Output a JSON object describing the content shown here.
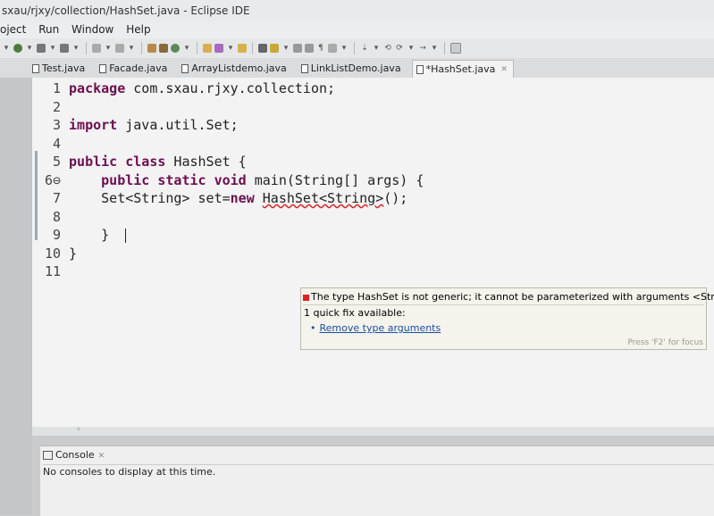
{
  "window": {
    "title": "sxau/rjxy/collection/HashSet.java - Eclipse IDE"
  },
  "menu": {
    "items": [
      "oject",
      "Run",
      "Window",
      "Help"
    ]
  },
  "tabs": [
    {
      "label": "Test.java",
      "active": false
    },
    {
      "label": "Facade.java",
      "active": false
    },
    {
      "label": "ArrayListdemo.java",
      "active": false
    },
    {
      "label": "LinkListDemo.java",
      "active": false
    },
    {
      "label": "*HashSet.java",
      "active": true,
      "close": "✕"
    }
  ],
  "editor": {
    "lines": [
      {
        "n": "1",
        "tokens": [
          {
            "t": "package",
            "k": "kw"
          },
          {
            "t": " com.sxau.rjxy.collection;"
          }
        ]
      },
      {
        "n": "2",
        "tokens": []
      },
      {
        "n": "3",
        "tokens": [
          {
            "t": "import",
            "k": "kw"
          },
          {
            "t": " java.util.Set;"
          }
        ]
      },
      {
        "n": "4",
        "tokens": []
      },
      {
        "n": "5",
        "tokens": [
          {
            "t": "public",
            "k": "kw"
          },
          {
            "t": " "
          },
          {
            "t": "class",
            "k": "kw"
          },
          {
            "t": " HashSet {"
          }
        ]
      },
      {
        "n": "6⊖",
        "tokens": [
          {
            "t": "    "
          },
          {
            "t": "public",
            "k": "kw"
          },
          {
            "t": " "
          },
          {
            "t": "static",
            "k": "kw"
          },
          {
            "t": " "
          },
          {
            "t": "void",
            "k": "kw"
          },
          {
            "t": " main(String[] args) {"
          }
        ]
      },
      {
        "n": "7",
        "tokens": [
          {
            "t": "    Set<String> set="
          },
          {
            "t": "new",
            "k": "kw"
          },
          {
            "t": " "
          },
          {
            "t": "HashSet<String>",
            "k": "err"
          },
          {
            "t": "();"
          }
        ]
      },
      {
        "n": "8",
        "tokens": []
      },
      {
        "n": "9",
        "tokens": [
          {
            "t": "    }  "
          }
        ],
        "cursor": true
      },
      {
        "n": "10",
        "tokens": [
          {
            "t": "}"
          }
        ]
      },
      {
        "n": "11",
        "tokens": []
      }
    ]
  },
  "hover": {
    "message": "The type HashSet is not generic; it cannot be parameterized with arguments <String>",
    "quickfix": "1 quick fix available:",
    "fix": "Remove type arguments",
    "hint": "Press 'F2' for focus"
  },
  "console": {
    "tab": "Console",
    "close": "✕",
    "message": "No consoles to display at this time."
  }
}
